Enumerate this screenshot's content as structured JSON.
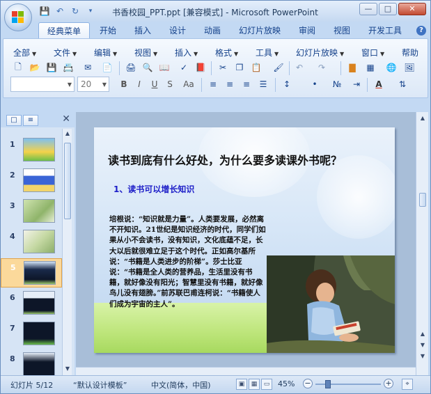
{
  "window": {
    "title": "书香校园_PPT.ppt [兼容模式] - Microsoft PowerPoint",
    "controls": [
      "—",
      "□",
      "✕"
    ]
  },
  "quick_access": {
    "icons": [
      "save-icon",
      "undo-icon",
      "redo-icon",
      "customize-icon"
    ]
  },
  "ribbon_tabs": [
    "经典菜单",
    "开始",
    "插入",
    "设计",
    "动画",
    "幻灯片放映",
    "审阅",
    "视图",
    "开发工具"
  ],
  "active_tab": "经典菜单",
  "menus": [
    "全部",
    "文件",
    "编辑",
    "视图",
    "插入",
    "格式",
    "工具",
    "幻灯片放映",
    "窗口",
    "帮助"
  ],
  "font": {
    "name_value": "",
    "size_value": "20"
  },
  "format_buttons": [
    "B",
    "I",
    "U",
    "S",
    "Aa"
  ],
  "left_pane": {
    "slides": [
      {
        "num": "1"
      },
      {
        "num": "2"
      },
      {
        "num": "3"
      },
      {
        "num": "4"
      },
      {
        "num": "5"
      },
      {
        "num": "6"
      },
      {
        "num": "7"
      },
      {
        "num": "8"
      }
    ],
    "selected_index": 4
  },
  "slide": {
    "title": "读书到底有什么好处，为什么要多读课外书呢？",
    "subtitle": "1、读书可以增长知识",
    "body": "培根说：“知识就是力量”。人类要发展，必然离不开知识。21世纪是知识经济的时代，同学们如果从小不会读书，没有知识，文化底蕴不足，长大以后就很难立足于这个时代。正如高尔基所说：“书籍是人类进步的阶梯”。莎士比亚说：“书籍是全人类的营养品，生活里没有书籍，就好像没有阳光；智慧里没有书籍，就好像鸟儿没有翅膀。”前苏联巴甫连柯说：“书籍使人们成为宇宙的主人”。"
  },
  "statusbar": {
    "slide_indicator": "幻灯片 5/12",
    "theme": "“默认设计模板”",
    "language": "中文(简体，中国)",
    "zoom": "45%",
    "zoom_level": 0.45
  },
  "colors": {
    "title_bar": "#c5d9f1",
    "ribbon_bg": "#dce8f7",
    "selected_thumb": "#fbd99b",
    "subtitle_blue": "#1d1ec8"
  }
}
